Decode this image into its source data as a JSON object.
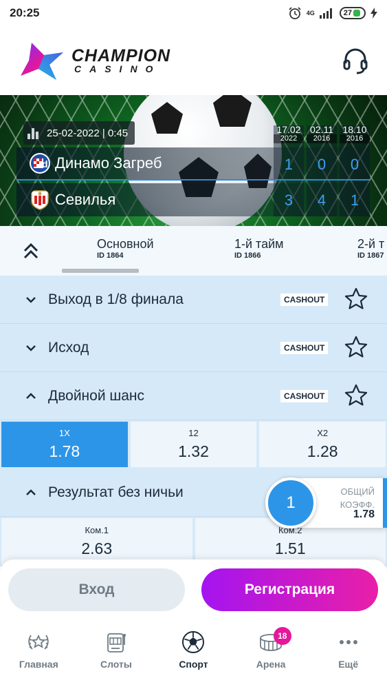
{
  "status_bar": {
    "time": "20:25",
    "network": "4G",
    "battery": "27"
  },
  "header": {
    "logo_line1": "CHAMPION",
    "logo_line2": "CASINO",
    "support_icon": "headset-icon"
  },
  "match": {
    "datetime": "25-02-2022 | 0:45",
    "home_team": "Динамо Загреб",
    "away_team": "Севилья",
    "history": [
      {
        "date": "17.02",
        "year": "2022",
        "home": "1",
        "away": "3"
      },
      {
        "date": "02.11",
        "year": "2016",
        "home": "0",
        "away": "4"
      },
      {
        "date": "18.10",
        "year": "2016",
        "home": "0",
        "away": "1"
      }
    ]
  },
  "tabs": [
    {
      "name": "Основной",
      "id": "ID 1864"
    },
    {
      "name": "1-й тайм",
      "id": "ID 1866"
    },
    {
      "name": "2-й т",
      "id": "ID 1867"
    }
  ],
  "markets": {
    "m1": {
      "title": "Выход в 1/8 финала",
      "badge": "CASHOUT"
    },
    "m2": {
      "title": "Исход",
      "badge": "CASHOUT"
    },
    "m3": {
      "title": "Двойной шанс",
      "badge": "CASHOUT",
      "odds": [
        {
          "label": "1X",
          "value": "1.78",
          "selected": true
        },
        {
          "label": "12",
          "value": "1.32"
        },
        {
          "label": "X2",
          "value": "1.28"
        }
      ]
    },
    "m4": {
      "title": "Результат без ничьи",
      "odds": [
        {
          "label": "Ком.1",
          "value": "2.63"
        },
        {
          "label": "Ком.2",
          "value": "1.51"
        }
      ]
    }
  },
  "betslip": {
    "count": "1",
    "label_line1": "ОБЩИЙ",
    "label_line2": "КОЭФФ.",
    "value": "1.78"
  },
  "auth": {
    "login": "Вход",
    "register": "Регистрация"
  },
  "nav": [
    {
      "label": "Главная",
      "icon": "laurel-star-icon"
    },
    {
      "label": "Слоты",
      "icon": "slot-machine-icon"
    },
    {
      "label": "Спорт",
      "icon": "soccer-ball-icon"
    },
    {
      "label": "Арена",
      "icon": "arena-icon",
      "badge": "18"
    },
    {
      "label": "Ещё",
      "icon": "more-dots-icon"
    }
  ],
  "colors": {
    "accent": "#2d95e8",
    "market_bg": "#d6e9f8",
    "register_start": "#a414f0",
    "register_end": "#ea1fa8",
    "badge": "#e5179a"
  }
}
